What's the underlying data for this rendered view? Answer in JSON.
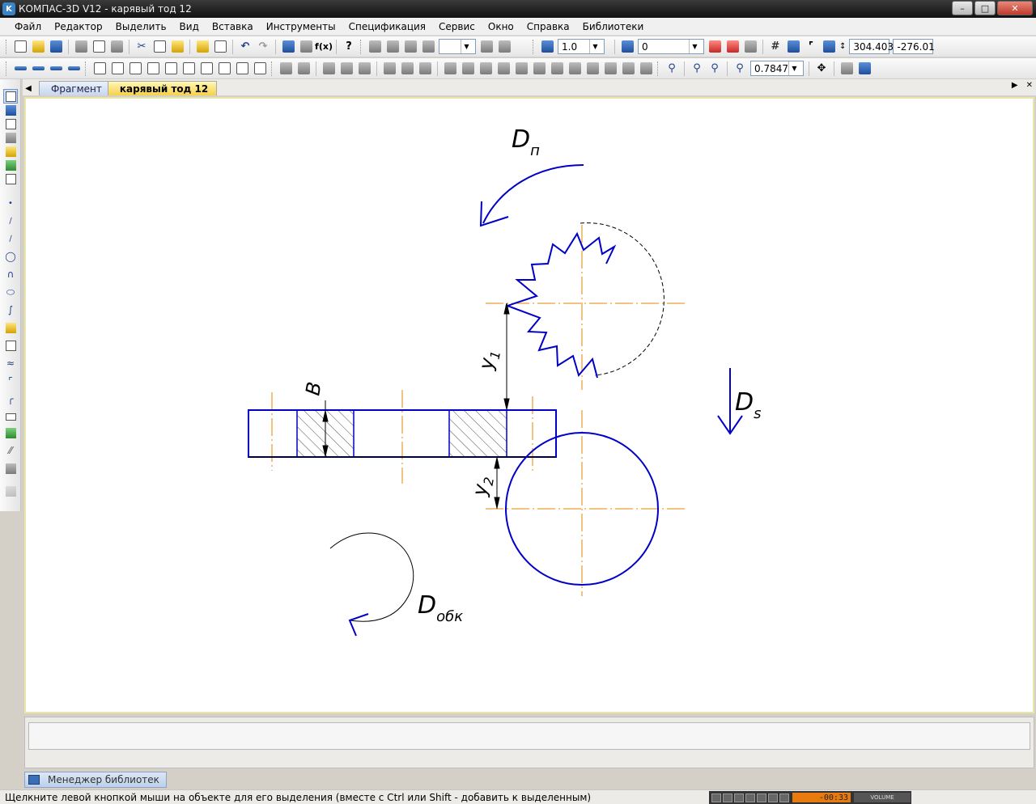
{
  "window": {
    "title": "КОМПАС-3D V12 - карявый тод 12",
    "app_icon": "K"
  },
  "menu": [
    "Файл",
    "Редактор",
    "Выделить",
    "Вид",
    "Вставка",
    "Инструменты",
    "Спецификация",
    "Сервис",
    "Окно",
    "Справка",
    "Библиотеки"
  ],
  "toolbar": {
    "step_value": "1.0",
    "layer_value": "0",
    "coord_x": "304.403",
    "coord_y": "-276.01",
    "zoom_value": "0.7847",
    "fx_label": "f(x)"
  },
  "tabs": [
    {
      "label": "Фрагмент",
      "active": false
    },
    {
      "label": "карявый тод 12",
      "active": true
    }
  ],
  "drawing": {
    "label_Dp": {
      "main": "D",
      "sub": "п"
    },
    "label_Ds": {
      "main": "D",
      "sub": "s"
    },
    "label_Dobk": {
      "main": "D",
      "sub": "обк"
    },
    "label_B": "B",
    "label_y1": {
      "main": "y",
      "sub": "1"
    },
    "label_y2": {
      "main": "y",
      "sub": "2"
    },
    "colors": {
      "contour": "#0000c8",
      "axis": "#e08a00",
      "dimension": "#000000"
    }
  },
  "status": {
    "hint": "Щелкните левой кнопкой мыши на объекте для его выделения (вместе с Ctrl или Shift - добавить к выделенным)",
    "library_manager": "Менеджер библиотек",
    "player_time": "-00:33",
    "player_volume": "VOLUME"
  }
}
